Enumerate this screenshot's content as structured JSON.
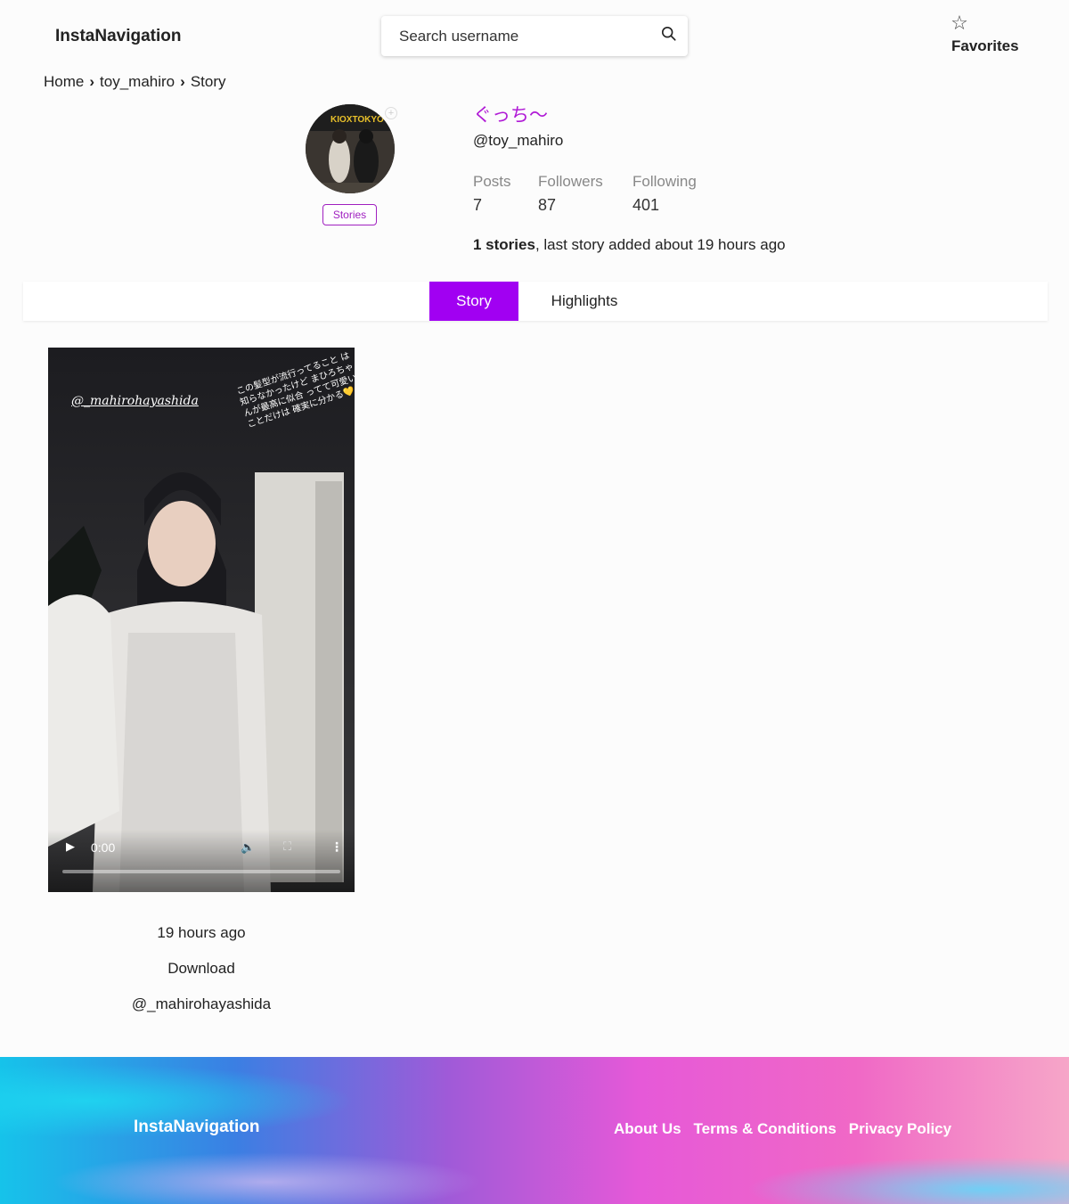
{
  "header": {
    "brand": "InstaNavigation",
    "search_placeholder": "Search username",
    "favorites_label": "Favorites"
  },
  "breadcrumb": [
    "Home",
    "toy_mahiro",
    "Story"
  ],
  "profile": {
    "display_name": "ぐっち〜",
    "handle": "@toy_mahiro",
    "stories_badge": "Stories",
    "avatar_text": "KIOXTOKYO",
    "stats": [
      {
        "label": "Posts",
        "value": "7"
      },
      {
        "label": "Followers",
        "value": "87"
      },
      {
        "label": "Following",
        "value": "401"
      }
    ],
    "summary_bold": "1 stories",
    "summary_rest": ", last story added about 19 hours ago"
  },
  "tabs": [
    {
      "label": "Story",
      "active": true
    },
    {
      "label": "Highlights",
      "active": false
    }
  ],
  "story_item": {
    "mention_overlay": "@_mahirohayashida",
    "caption_overlay": "この髪型が流行ってること は知らなかったけど まひろちゃんが最高に似合 ってて可愛いことだけは 確実に分かる💛",
    "time_display": "0:00",
    "posted": "19 hours ago",
    "download_label": "Download",
    "mention": "@_mahirohayashida"
  },
  "footer": {
    "brand": "InstaNavigation",
    "links": [
      "About Us",
      "Terms & Conditions",
      "Privacy Policy"
    ]
  },
  "colors": {
    "accent": "#a100f2",
    "display_name": "#b01ad6",
    "badge": "#a020c0"
  }
}
